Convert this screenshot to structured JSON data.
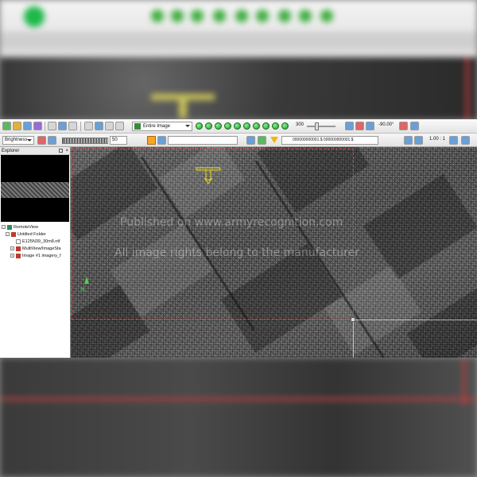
{
  "toolbar": {
    "view_select": "Entire Image",
    "zoom_value": "300",
    "angle_value": "-90.00°"
  },
  "adjust_bar": {
    "mode_select": "Brightness",
    "level_value": "50",
    "coords": "000000000001.$ 000000000001.$",
    "scale": "1.00 : 1"
  },
  "explorer": {
    "title": "Explorer",
    "tree": [
      {
        "label": "RemoteView",
        "icon": "globe-icon",
        "color": "#2e8b57"
      },
      {
        "label": "Untitled Folder",
        "icon": "folder-icon",
        "color": "#c0392b"
      },
      {
        "label": "E125N39_30m8.ntf",
        "icon": "file-icon",
        "color": "#ffffff"
      },
      {
        "label": "MultiView/ImageSta",
        "icon": "image-icon",
        "color": "#c0392b"
      },
      {
        "label": "Image #1 imagery_f",
        "icon": "image-icon",
        "color": "#c0392b"
      }
    ]
  },
  "viewer": {
    "watermark_1": "Published on www.armyrecognition.com",
    "watermark_2": "All image rights belong to the manufacturer",
    "north_label": "N",
    "selection_color": "#ff3b3b",
    "marker_color": "#e6d81e"
  }
}
